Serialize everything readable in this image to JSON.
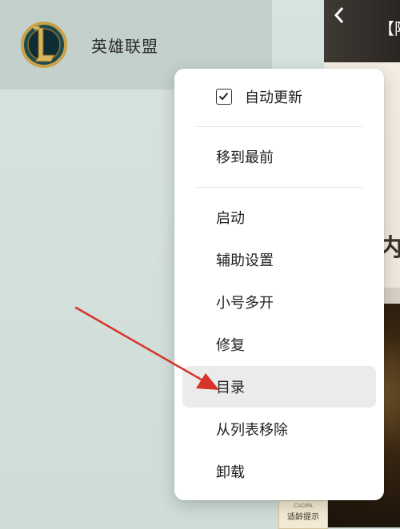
{
  "game": {
    "name": "英雄联盟",
    "logo_letter": "L"
  },
  "background": {
    "back_icon": "chevron-left-icon",
    "title_fragment": "【阿",
    "side_fragment": "内",
    "badge_top": "CADPA",
    "badge_bottom": "适龄提示"
  },
  "menu": {
    "auto_update": {
      "label": "自动更新",
      "checked": true
    },
    "move_front": "移到最前",
    "items": [
      "启动",
      "辅助设置",
      "小号多开",
      "修复",
      "目录",
      "从列表移除",
      "卸载"
    ],
    "highlighted_item": "目录"
  },
  "colors": {
    "arrow": "#d6332a",
    "hover_bg": "#ebebeb",
    "logo_gold": "#c9a24a"
  }
}
